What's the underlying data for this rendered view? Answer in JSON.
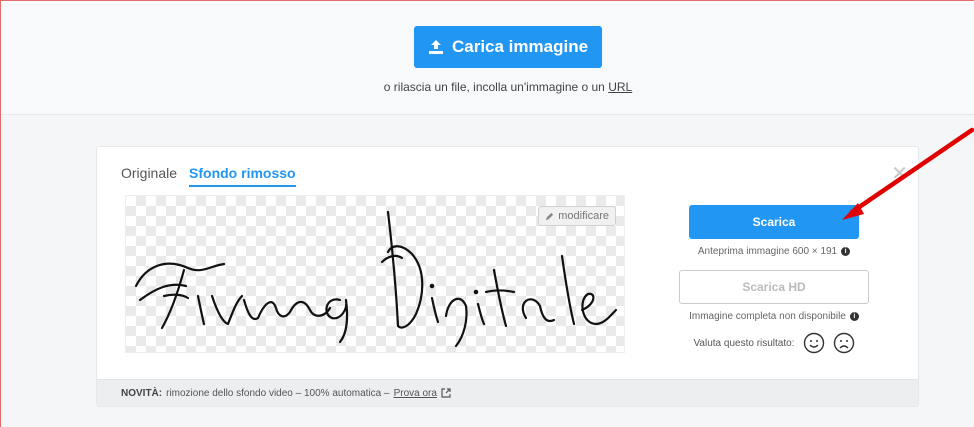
{
  "upload": {
    "button_label": "Carica immagine",
    "hint_prefix": "o rilascia un file, incolla un'immagine o un",
    "hint_link": "URL"
  },
  "result": {
    "tabs": [
      {
        "label": "Originale",
        "active": false
      },
      {
        "label": "Sfondo rimosso",
        "active": true
      }
    ],
    "close_symbol": "✕",
    "edit_label": "modificare",
    "download_label": "Scarica",
    "preview_note": "Anteprima immagine 600 × 191",
    "download_hd_label": "Scarica HD",
    "hd_note": "Immagine completa non disponibile",
    "rate_label": "Valuta questo risultato:"
  },
  "footer": {
    "new_label": "NOVITÀ:",
    "text": "rimozione dello sfondo video – 100% automatica –",
    "link_label": "Prova ora"
  },
  "colors": {
    "accent": "#2296f3",
    "annotation_arrow": "#e00000"
  },
  "icons": [
    "upload-icon",
    "pencil-icon",
    "info-icon",
    "smile-icon",
    "frown-icon",
    "external-link-icon",
    "close-icon"
  ]
}
